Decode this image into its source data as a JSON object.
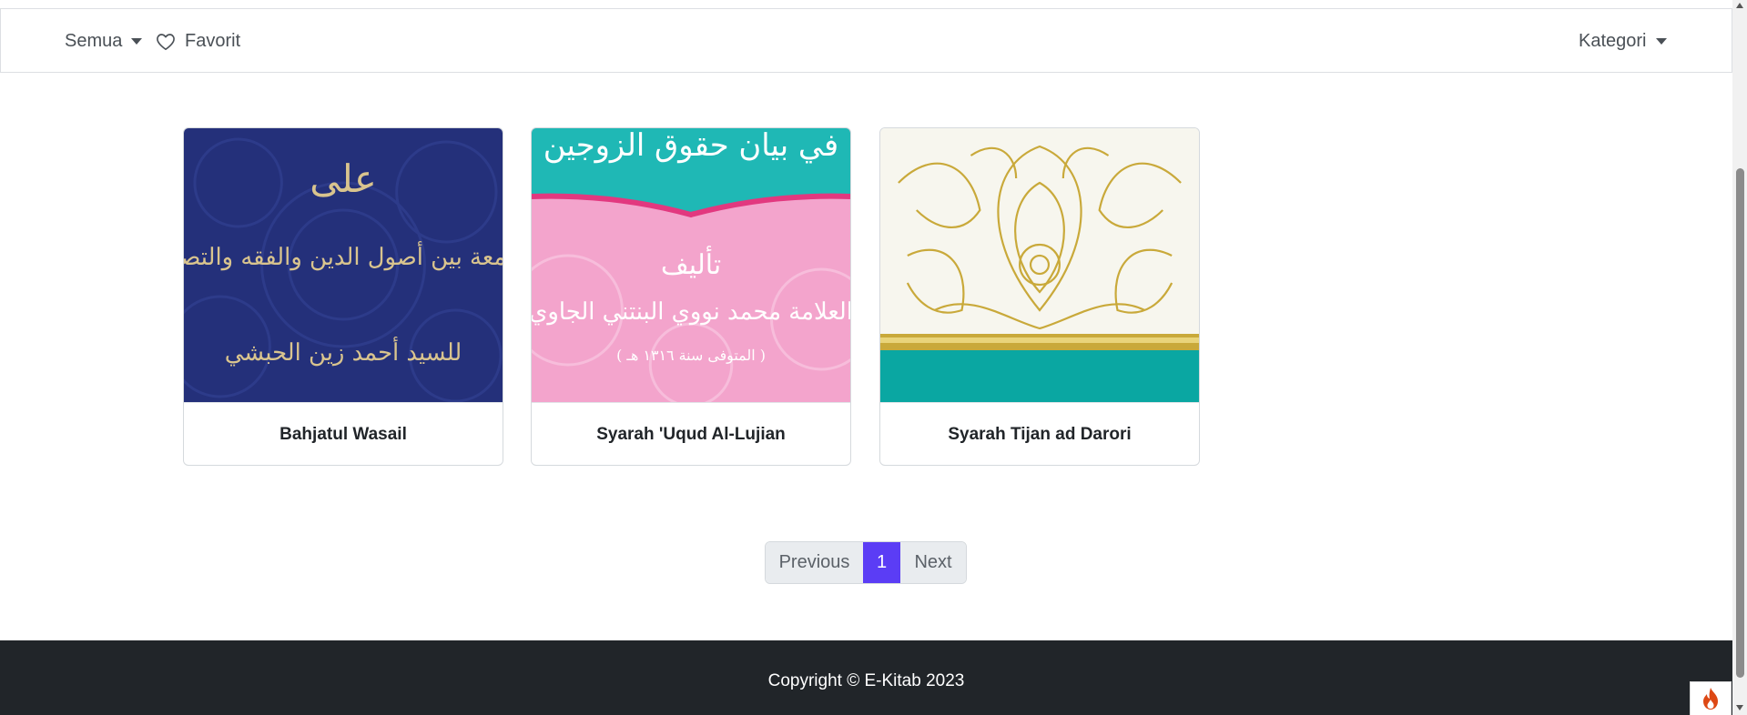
{
  "navbar": {
    "filter_label": "Semua",
    "favorite_label": "Favorit",
    "category_label": "Kategori"
  },
  "books": [
    {
      "title": "Bahjatul Wasail"
    },
    {
      "title": "Syarah 'Uqud Al-Lujian"
    },
    {
      "title": "Syarah Tijan ad Darori"
    }
  ],
  "covers": {
    "book1_text": [
      "على",
      "الجامعة بين أصول الدين والفقه والتصوف",
      "للسيد أحمد زين الحبشي"
    ],
    "book2_text": [
      "في بيان حقوق الزوجين",
      "تأليف",
      "العلامة محمد نووي البنتني الجاوي",
      "( المتوفى سنة ١٣١٦ هـ )"
    ]
  },
  "pagination": {
    "previous": "Previous",
    "current": "1",
    "next": "Next"
  },
  "footer": {
    "copyright": "Copyright © E-Kitab 2023"
  },
  "colors": {
    "accent": "#5b3df5",
    "footer_bg": "#212529",
    "cover1_bg": "#24307a",
    "cover2_pink": "#f3a4cc",
    "cover2_teal": "#1fb8b5",
    "cover3_teal": "#0aa7a2",
    "cover3_gold": "#c9a93a"
  },
  "icons": {
    "favorite": "heart-outline-icon",
    "dropdown": "caret-down-icon",
    "debug": "flame-icon"
  }
}
